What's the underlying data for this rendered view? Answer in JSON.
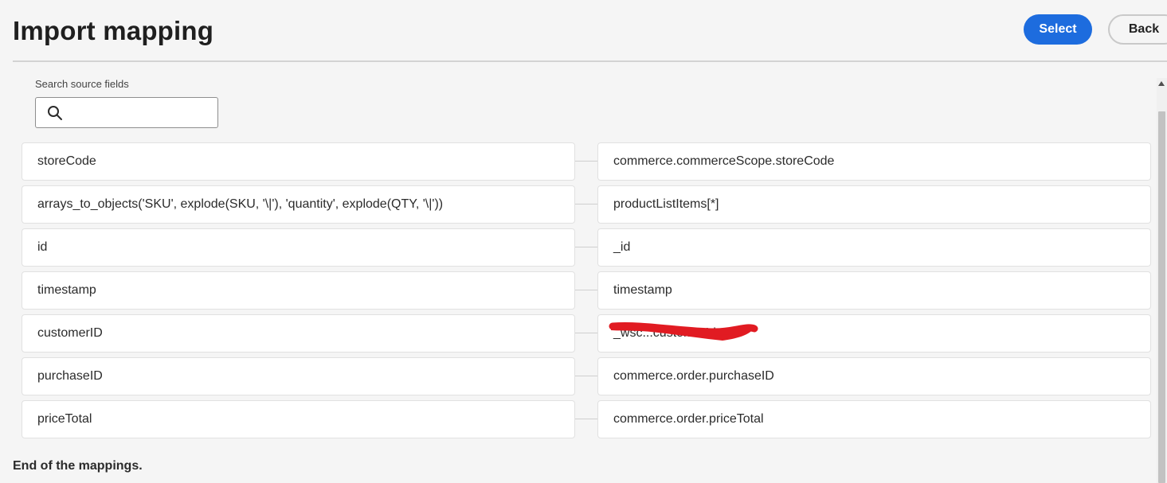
{
  "header": {
    "title": "Import mapping",
    "select_label": "Select",
    "back_label": "Back"
  },
  "search": {
    "label": "Search source fields",
    "value": "",
    "placeholder": ""
  },
  "mappings": [
    {
      "source": "storeCode",
      "target": "commerce.commerceScope.storeCode"
    },
    {
      "source": "arrays_to_objects('SKU', explode(SKU, '\\|'), 'quantity', explode(QTY, '\\|'))",
      "target": "productListItems[*]"
    },
    {
      "source": "id",
      "target": "_id"
    },
    {
      "source": "timestamp",
      "target": "timestamp"
    },
    {
      "source": "customerID",
      "target": "_wsc...customerId"
    },
    {
      "source": "purchaseID",
      "target": "commerce.order.purchaseID"
    },
    {
      "source": "priceTotal",
      "target": "commerce.order.priceTotal"
    }
  ],
  "footer": {
    "end_text": "End of the mappings."
  },
  "colors": {
    "accent": "#1d6cde",
    "redaction": "#e11b22"
  }
}
